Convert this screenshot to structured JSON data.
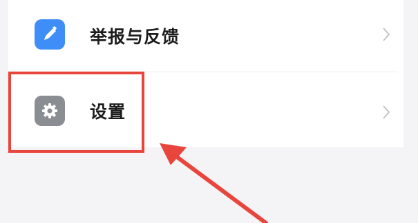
{
  "menu": {
    "items": [
      {
        "label": "举报与反馈",
        "icon": "pencil-icon",
        "icon_color": "#3f8ef7"
      },
      {
        "label": "设置",
        "icon": "gear-icon",
        "icon_color": "#8a8d92"
      }
    ]
  },
  "annotation": {
    "highlight_color": "#e8463c",
    "arrow_color": "#e8463c",
    "highlight_target": "设置"
  }
}
